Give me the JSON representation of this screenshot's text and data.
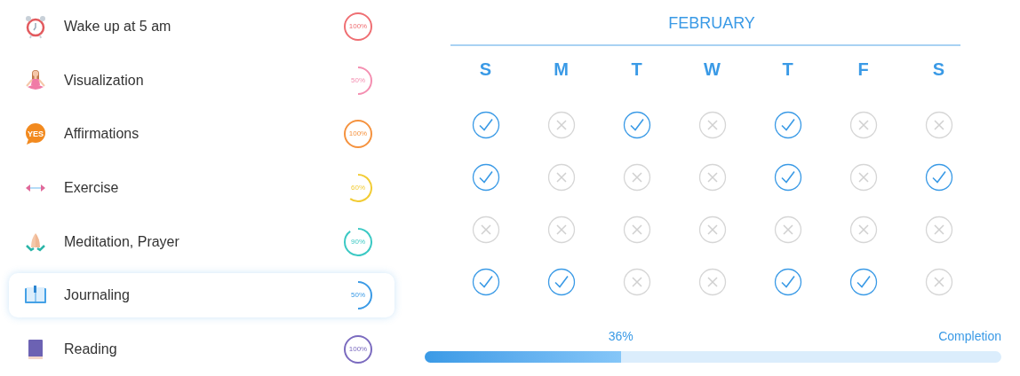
{
  "habits": [
    {
      "kind": "clock",
      "name": "Wake up at 5 am",
      "percent": "100%",
      "color": "#ef6f73",
      "selected": false
    },
    {
      "kind": "figure",
      "name": "Visualization",
      "percent": "50%",
      "color": "#f48fb1",
      "selected": false
    },
    {
      "kind": "bubble",
      "icon_text": "YES",
      "name": "Affirmations",
      "percent": "100%",
      "color": "#f5923e",
      "selected": false
    },
    {
      "kind": "dumbbell",
      "name": "Exercise",
      "percent": "60%",
      "color": "#f2cc35",
      "selected": false
    },
    {
      "kind": "hands",
      "name": "Meditation, Prayer",
      "percent": "90%",
      "color": "#3cc9c4",
      "selected": false
    },
    {
      "kind": "open-book",
      "name": "Journaling",
      "percent": "50%",
      "color": "#3a9ae6",
      "selected": true
    },
    {
      "kind": "closed-book",
      "name": "Reading",
      "percent": "100%",
      "color": "#7b6bbf",
      "selected": false
    }
  ],
  "calendar": {
    "month": "FEBRUARY",
    "weekdays": [
      "S",
      "M",
      "T",
      "W",
      "T",
      "F",
      "S"
    ],
    "weeks": [
      [
        {
          "checked": true
        },
        {
          "checked": false
        },
        {
          "checked": true
        },
        {
          "checked": false
        },
        {
          "checked": true
        },
        {
          "checked": false
        },
        {
          "checked": false
        }
      ],
      [
        {
          "checked": true
        },
        {
          "checked": false
        },
        {
          "checked": false
        },
        {
          "checked": false
        },
        {
          "checked": true
        },
        {
          "checked": false
        },
        {
          "checked": true
        }
      ],
      [
        {
          "checked": false
        },
        {
          "checked": false
        },
        {
          "checked": false
        },
        {
          "checked": false
        },
        {
          "checked": false
        },
        {
          "checked": false
        },
        {
          "checked": false
        }
      ],
      [
        {
          "checked": true
        },
        {
          "checked": true
        },
        {
          "checked": false
        },
        {
          "checked": false
        },
        {
          "checked": true
        },
        {
          "checked": true
        },
        {
          "checked": false
        }
      ]
    ]
  },
  "completion": {
    "reading": "36%",
    "label": "Completion",
    "level": 0.34
  }
}
